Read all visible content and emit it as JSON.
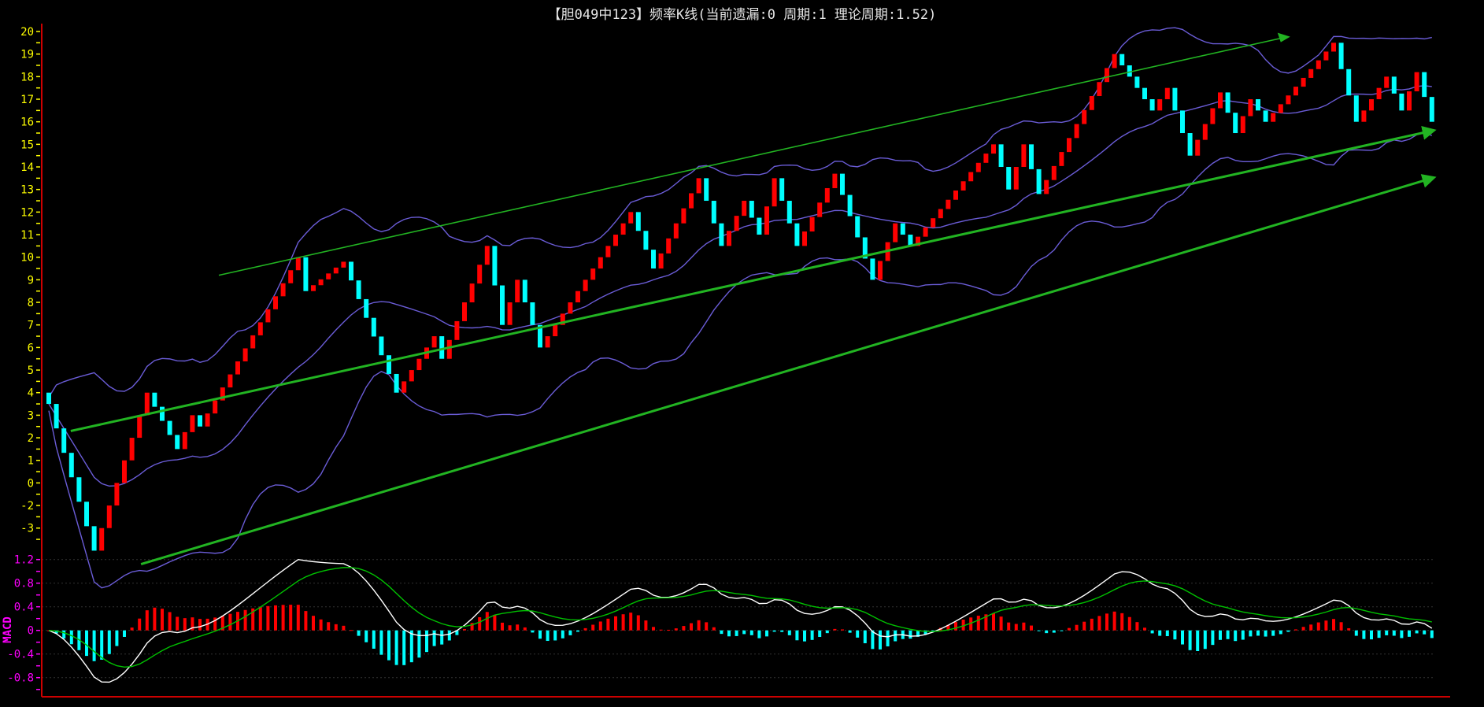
{
  "title": "【胆049中123】频率K线(当前遗漏:0 周期:1 理论周期:1.52)",
  "colors": {
    "up": "#ff0000",
    "down": "#00ffff",
    "band": "#6a5cd6",
    "trend": "#22b422",
    "dif": "#ffffff",
    "dea": "#00c000",
    "axis": "#cc0000",
    "price_label": "#ffff00",
    "macd_label": "#ff00ff"
  },
  "chart_data": [
    {
      "type": "candlestick",
      "title": "【胆049中123】频率K线(当前遗漏:0 周期:1 理论周期:1.52)",
      "y_labels": [
        {
          "text": "20",
          "value": 20
        },
        {
          "text": "19",
          "value": 19
        },
        {
          "text": "18",
          "value": 18
        },
        {
          "text": "17",
          "value": 17
        },
        {
          "text": "16",
          "value": 16
        },
        {
          "text": "15",
          "value": 15
        },
        {
          "text": "14",
          "value": 14
        },
        {
          "text": "13",
          "value": 13
        },
        {
          "text": "12",
          "value": 12
        },
        {
          "text": "11",
          "value": 11
        },
        {
          "text": "10",
          "value": 10
        },
        {
          "text": "9",
          "value": 9
        },
        {
          "text": "8",
          "value": 8
        },
        {
          "text": "7",
          "value": 7
        },
        {
          "text": "6",
          "value": 6
        },
        {
          "text": "5",
          "value": 5
        },
        {
          "text": "4",
          "value": 4
        },
        {
          "text": "3",
          "value": 3
        },
        {
          "text": "2",
          "value": 2
        },
        {
          "text": "1",
          "value": 1
        },
        {
          "text": "0",
          "value": 0
        },
        {
          "text": "-2",
          "value": -1
        },
        {
          "text": "-3",
          "value": -2
        }
      ],
      "ylim": [
        -3,
        20
      ],
      "bar_count": 184,
      "pivots": [
        [
          0,
          3.5
        ],
        [
          6,
          -3
        ],
        [
          13,
          4
        ],
        [
          17,
          1.5
        ],
        [
          19,
          3
        ],
        [
          20,
          2.5
        ],
        [
          33,
          10
        ],
        [
          34,
          8.5
        ],
        [
          39,
          9.8
        ],
        [
          46,
          4
        ],
        [
          51,
          6.5
        ],
        [
          52,
          5.5
        ],
        [
          58,
          10.5
        ],
        [
          60,
          7
        ],
        [
          62,
          9
        ],
        [
          65,
          6
        ],
        [
          77,
          12
        ],
        [
          80,
          9.5
        ],
        [
          86,
          13.5
        ],
        [
          89,
          10.5
        ],
        [
          92,
          12.5
        ],
        [
          94,
          11
        ],
        [
          96,
          13.5
        ],
        [
          99,
          10.5
        ],
        [
          104,
          13.7
        ],
        [
          109,
          9
        ],
        [
          112,
          11.5
        ],
        [
          114,
          10.5
        ],
        [
          125,
          15
        ],
        [
          127,
          13
        ],
        [
          129,
          15
        ],
        [
          131,
          12.8
        ],
        [
          141,
          19
        ],
        [
          146,
          16.5
        ],
        [
          148,
          17.5
        ],
        [
          151,
          14.5
        ],
        [
          155,
          17.3
        ],
        [
          157,
          15.5
        ],
        [
          159,
          17
        ],
        [
          161,
          16
        ],
        [
          170,
          19.5
        ],
        [
          173,
          16
        ],
        [
          177,
          18
        ],
        [
          179,
          16.5
        ],
        [
          181,
          18.2
        ],
        [
          183,
          16
        ]
      ],
      "bollinger": {
        "period": 20,
        "k": 2
      },
      "trend_lines": [
        {
          "name": "upper-trend-line",
          "from": [
            22.5,
            9.2
          ],
          "to": [
            163,
            19.7
          ],
          "width": "thin"
        },
        {
          "name": "middle-trend-line",
          "from": [
            2.9,
            2.3
          ],
          "to": [
            183,
            15.6
          ],
          "width": "thick"
        },
        {
          "name": "lower-trend-line",
          "from": [
            12.2,
            -3.6
          ],
          "to": [
            183,
            13.5
          ],
          "width": "thick"
        }
      ]
    },
    {
      "type": "bar",
      "title": "MACD",
      "ylabel": "MACD",
      "y_labels": [
        {
          "text": "1.2",
          "value": 1.2
        },
        {
          "text": "0.8",
          "value": 0.8
        },
        {
          "text": "0.4",
          "value": 0.4
        },
        {
          "text": "0",
          "value": 0
        },
        {
          "text": "-0.4",
          "value": -0.4
        },
        {
          "text": "-0.8",
          "value": -0.8
        }
      ],
      "ylim": [
        -1.1,
        1.3
      ],
      "series": [
        {
          "name": "DIF"
        },
        {
          "name": "DEA"
        },
        {
          "name": "MACD histogram"
        }
      ]
    }
  ]
}
